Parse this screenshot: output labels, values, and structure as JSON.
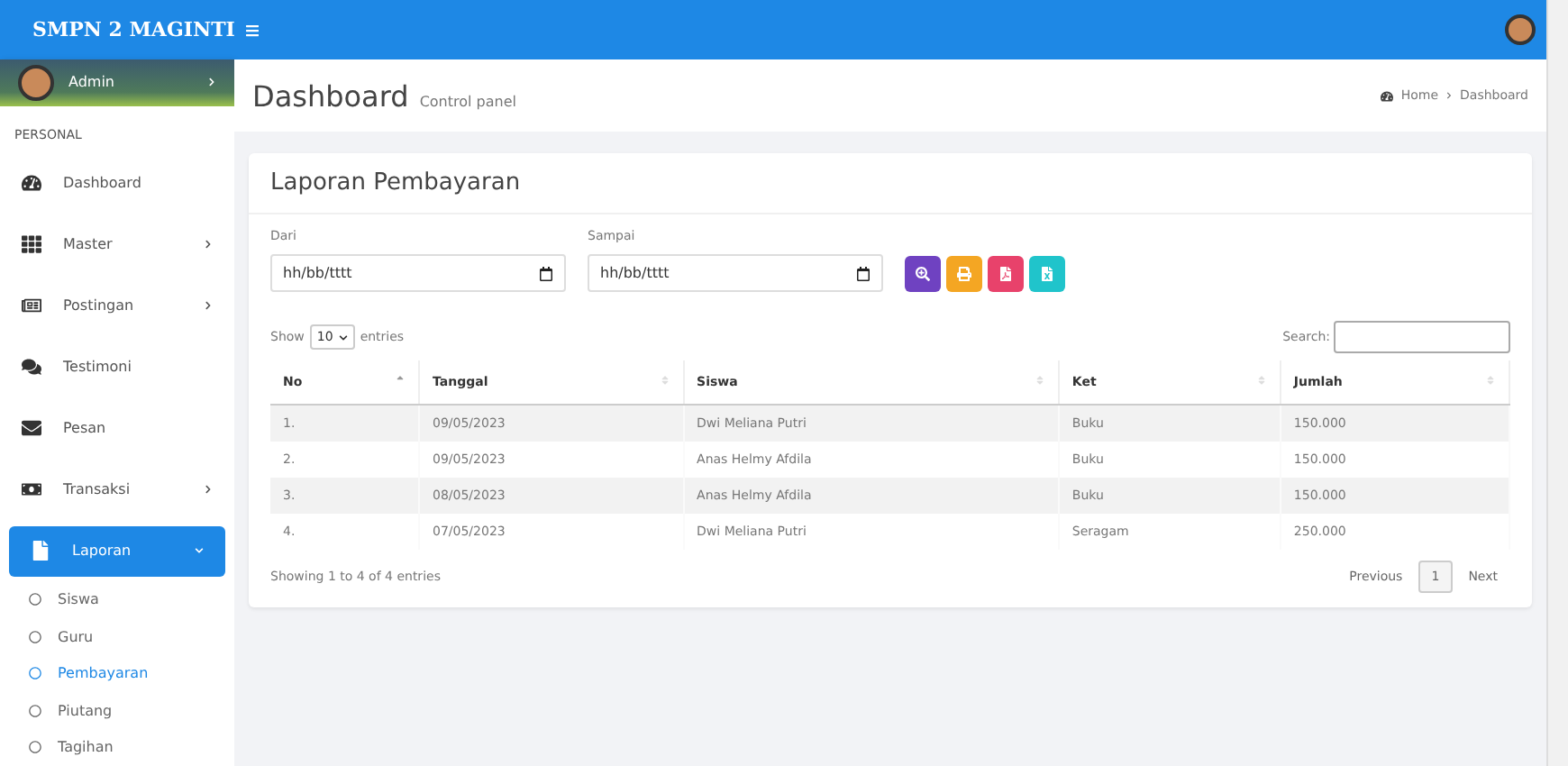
{
  "brand": {
    "title": "SMPN 2 MAGINTI"
  },
  "user_panel": {
    "name": "Admin"
  },
  "sidebar": {
    "section": "PERSONAL",
    "items": [
      {
        "label": "Dashboard",
        "has_submenu": false,
        "selected": false
      },
      {
        "label": "Master",
        "has_submenu": true,
        "selected": false
      },
      {
        "label": "Postingan",
        "has_submenu": true,
        "selected": false
      },
      {
        "label": "Testimoni",
        "has_submenu": false,
        "selected": false
      },
      {
        "label": "Pesan",
        "has_submenu": false,
        "selected": false
      },
      {
        "label": "Transaksi",
        "has_submenu": true,
        "selected": false
      },
      {
        "label": "Laporan",
        "has_submenu": true,
        "selected": true,
        "expanded": true,
        "children": [
          {
            "label": "Siswa",
            "selected": false
          },
          {
            "label": "Guru",
            "selected": false
          },
          {
            "label": "Pembayaran",
            "selected": true
          },
          {
            "label": "Piutang",
            "selected": false
          },
          {
            "label": "Tagihan",
            "selected": false
          }
        ]
      }
    ]
  },
  "page_header": {
    "title": "Dashboard",
    "subtitle": "Control panel",
    "breadcrumb": [
      "Home",
      "Dashboard"
    ]
  },
  "card": {
    "title": "Laporan Pembayaran",
    "filters": [
      {
        "label": "Dari",
        "placeholder": "hh/bb/tttt"
      },
      {
        "label": "Sampai",
        "placeholder": "hh/bb/tttt"
      }
    ],
    "actions": [
      {
        "kind": "search",
        "color": "#6f42c1"
      },
      {
        "kind": "print",
        "color": "#f4a623"
      },
      {
        "kind": "pdf",
        "color": "#e8426b"
      },
      {
        "kind": "excel",
        "color": "#20c4cb"
      }
    ],
    "length": {
      "before": "Show",
      "value": "10",
      "after": "entries"
    },
    "search_label": "Search:",
    "table": {
      "columns": [
        {
          "label": "No",
          "sorted": true
        },
        {
          "label": "Tanggal",
          "sorted": false
        },
        {
          "label": "Siswa",
          "sorted": false
        },
        {
          "label": "Ket",
          "sorted": false
        },
        {
          "label": "Jumlah",
          "sorted": false
        }
      ],
      "rows": [
        [
          "1.",
          "09/05/2023",
          "Dwi Meliana Putri",
          "Buku",
          "150.000"
        ],
        [
          "2.",
          "09/05/2023",
          "Anas Helmy Afdila",
          "Buku",
          "150.000"
        ],
        [
          "3.",
          "08/05/2023",
          "Anas Helmy Afdila",
          "Buku",
          "150.000"
        ],
        [
          "4.",
          "07/05/2023",
          "Dwi Meliana Putri",
          "Seragam",
          "250.000"
        ]
      ]
    },
    "info": "Showing 1 to 4 of 4 entries",
    "pagination": [
      {
        "label": "Previous",
        "selected": false
      },
      {
        "label": "1",
        "selected": true
      },
      {
        "label": "Next",
        "selected": false
      }
    ]
  }
}
